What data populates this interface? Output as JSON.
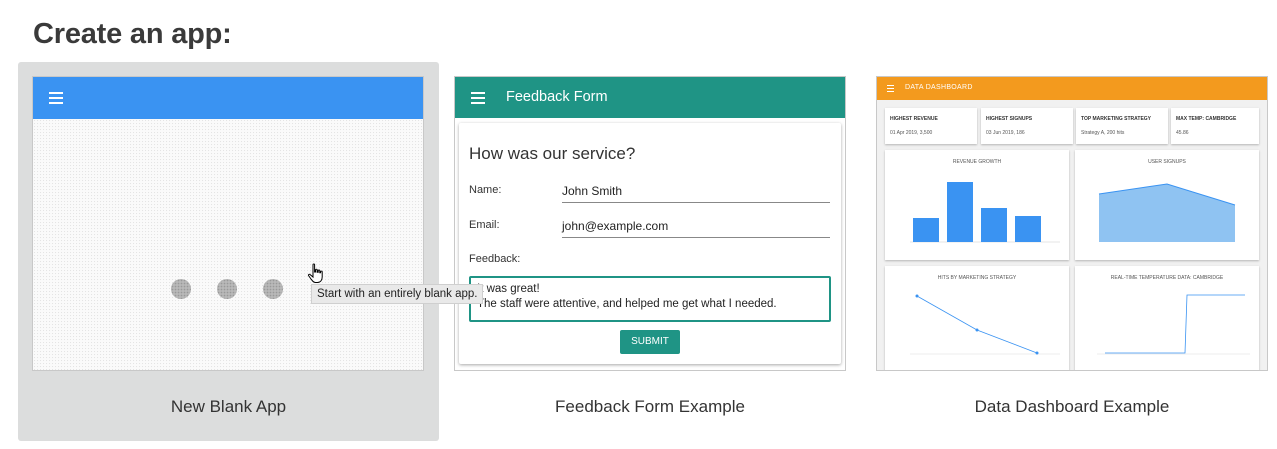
{
  "heading": "Create an app:",
  "cards": {
    "blank": {
      "label": "New Blank App",
      "tooltip": "Start with an entirely blank app."
    },
    "feedback": {
      "label": "Feedback Form Example",
      "app_title": "Feedback Form",
      "question": "How was our service?",
      "name_label": "Name:",
      "name_value": "John Smith",
      "email_label": "Email:",
      "email_value": "john@example.com",
      "feedback_label": "Feedback:",
      "feedback_line1": "It was great!",
      "feedback_line2": "The staff were attentive, and helped me get what I needed.",
      "submit_label": "SUBMIT"
    },
    "dashboard": {
      "label": "Data Dashboard Example",
      "app_title": "DATA DASHBOARD",
      "kpis": [
        {
          "title": "HIGHEST REVENUE",
          "value": "01 Apr 2019, 3,500"
        },
        {
          "title": "HIGHEST SIGNUPS",
          "value": "03 Jun 2019, 186"
        },
        {
          "title": "TOP MARKETING STRATEGY",
          "value": "Strategy A, 200 hits"
        },
        {
          "title": "MAX TEMP: CAMBRIDGE",
          "value": "45.86"
        }
      ],
      "panels": [
        "REVENUE GROWTH",
        "USER SIGNUPS",
        "HITS BY MARKETING STRATEGY",
        "REAL-TIME TEMPERATURE DATA: CAMBRIDGE"
      ]
    }
  },
  "colors": {
    "blank_bar": "#3a93f2",
    "feedback_bar": "#1f9485",
    "dashboard_bar": "#f39a1e",
    "selected_card_bg": "#dcdddd"
  }
}
